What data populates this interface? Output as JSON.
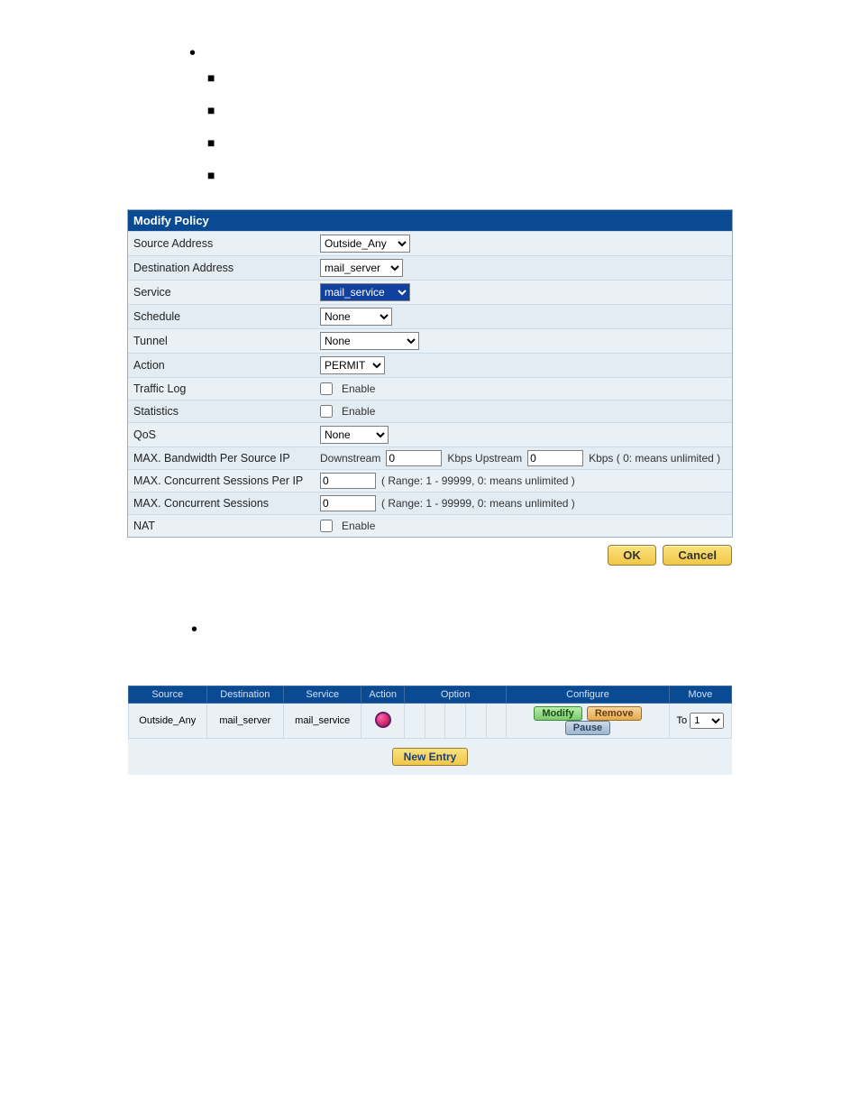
{
  "form": {
    "title": "Modify Policy",
    "rows": {
      "source_address": {
        "label": "Source Address",
        "value": "Outside_Any"
      },
      "destination_address": {
        "label": "Destination Address",
        "value": "mail_server"
      },
      "service": {
        "label": "Service",
        "value": "mail_service"
      },
      "schedule": {
        "label": "Schedule",
        "value": "None"
      },
      "tunnel": {
        "label": "Tunnel",
        "value": "None"
      },
      "action": {
        "label": "Action",
        "value": "PERMIT"
      },
      "traffic_log": {
        "label": "Traffic Log",
        "enable_text": "Enable"
      },
      "statistics": {
        "label": "Statistics",
        "enable_text": "Enable"
      },
      "qos": {
        "label": "QoS",
        "value": "None"
      },
      "bw": {
        "label": "MAX. Bandwidth Per Source IP",
        "down_label": "Downstream",
        "down_value": "0",
        "up_label": "Kbps Upstream",
        "up_value": "0",
        "suffix": "Kbps ( 0: means unlimited )"
      },
      "sess_ip": {
        "label": "MAX. Concurrent Sessions Per IP",
        "value": "0",
        "hint": "( Range: 1 - 99999, 0: means unlimited )"
      },
      "sess": {
        "label": "MAX. Concurrent Sessions",
        "value": "0",
        "hint": "( Range: 1 - 99999, 0: means unlimited )"
      },
      "nat": {
        "label": "NAT",
        "enable_text": "Enable"
      }
    },
    "buttons": {
      "ok": "OK",
      "cancel": "Cancel"
    }
  },
  "list": {
    "headers": {
      "source": "Source",
      "destination": "Destination",
      "service": "Service",
      "action": "Action",
      "option": "Option",
      "configure": "Configure",
      "move": "Move"
    },
    "row": {
      "source": "Outside_Any",
      "destination": "mail_server",
      "service": "mail_service",
      "configure": {
        "modify": "Modify",
        "remove": "Remove",
        "pause": "Pause"
      },
      "move": {
        "label": "To",
        "value": "1"
      }
    },
    "new_entry": "New Entry"
  }
}
